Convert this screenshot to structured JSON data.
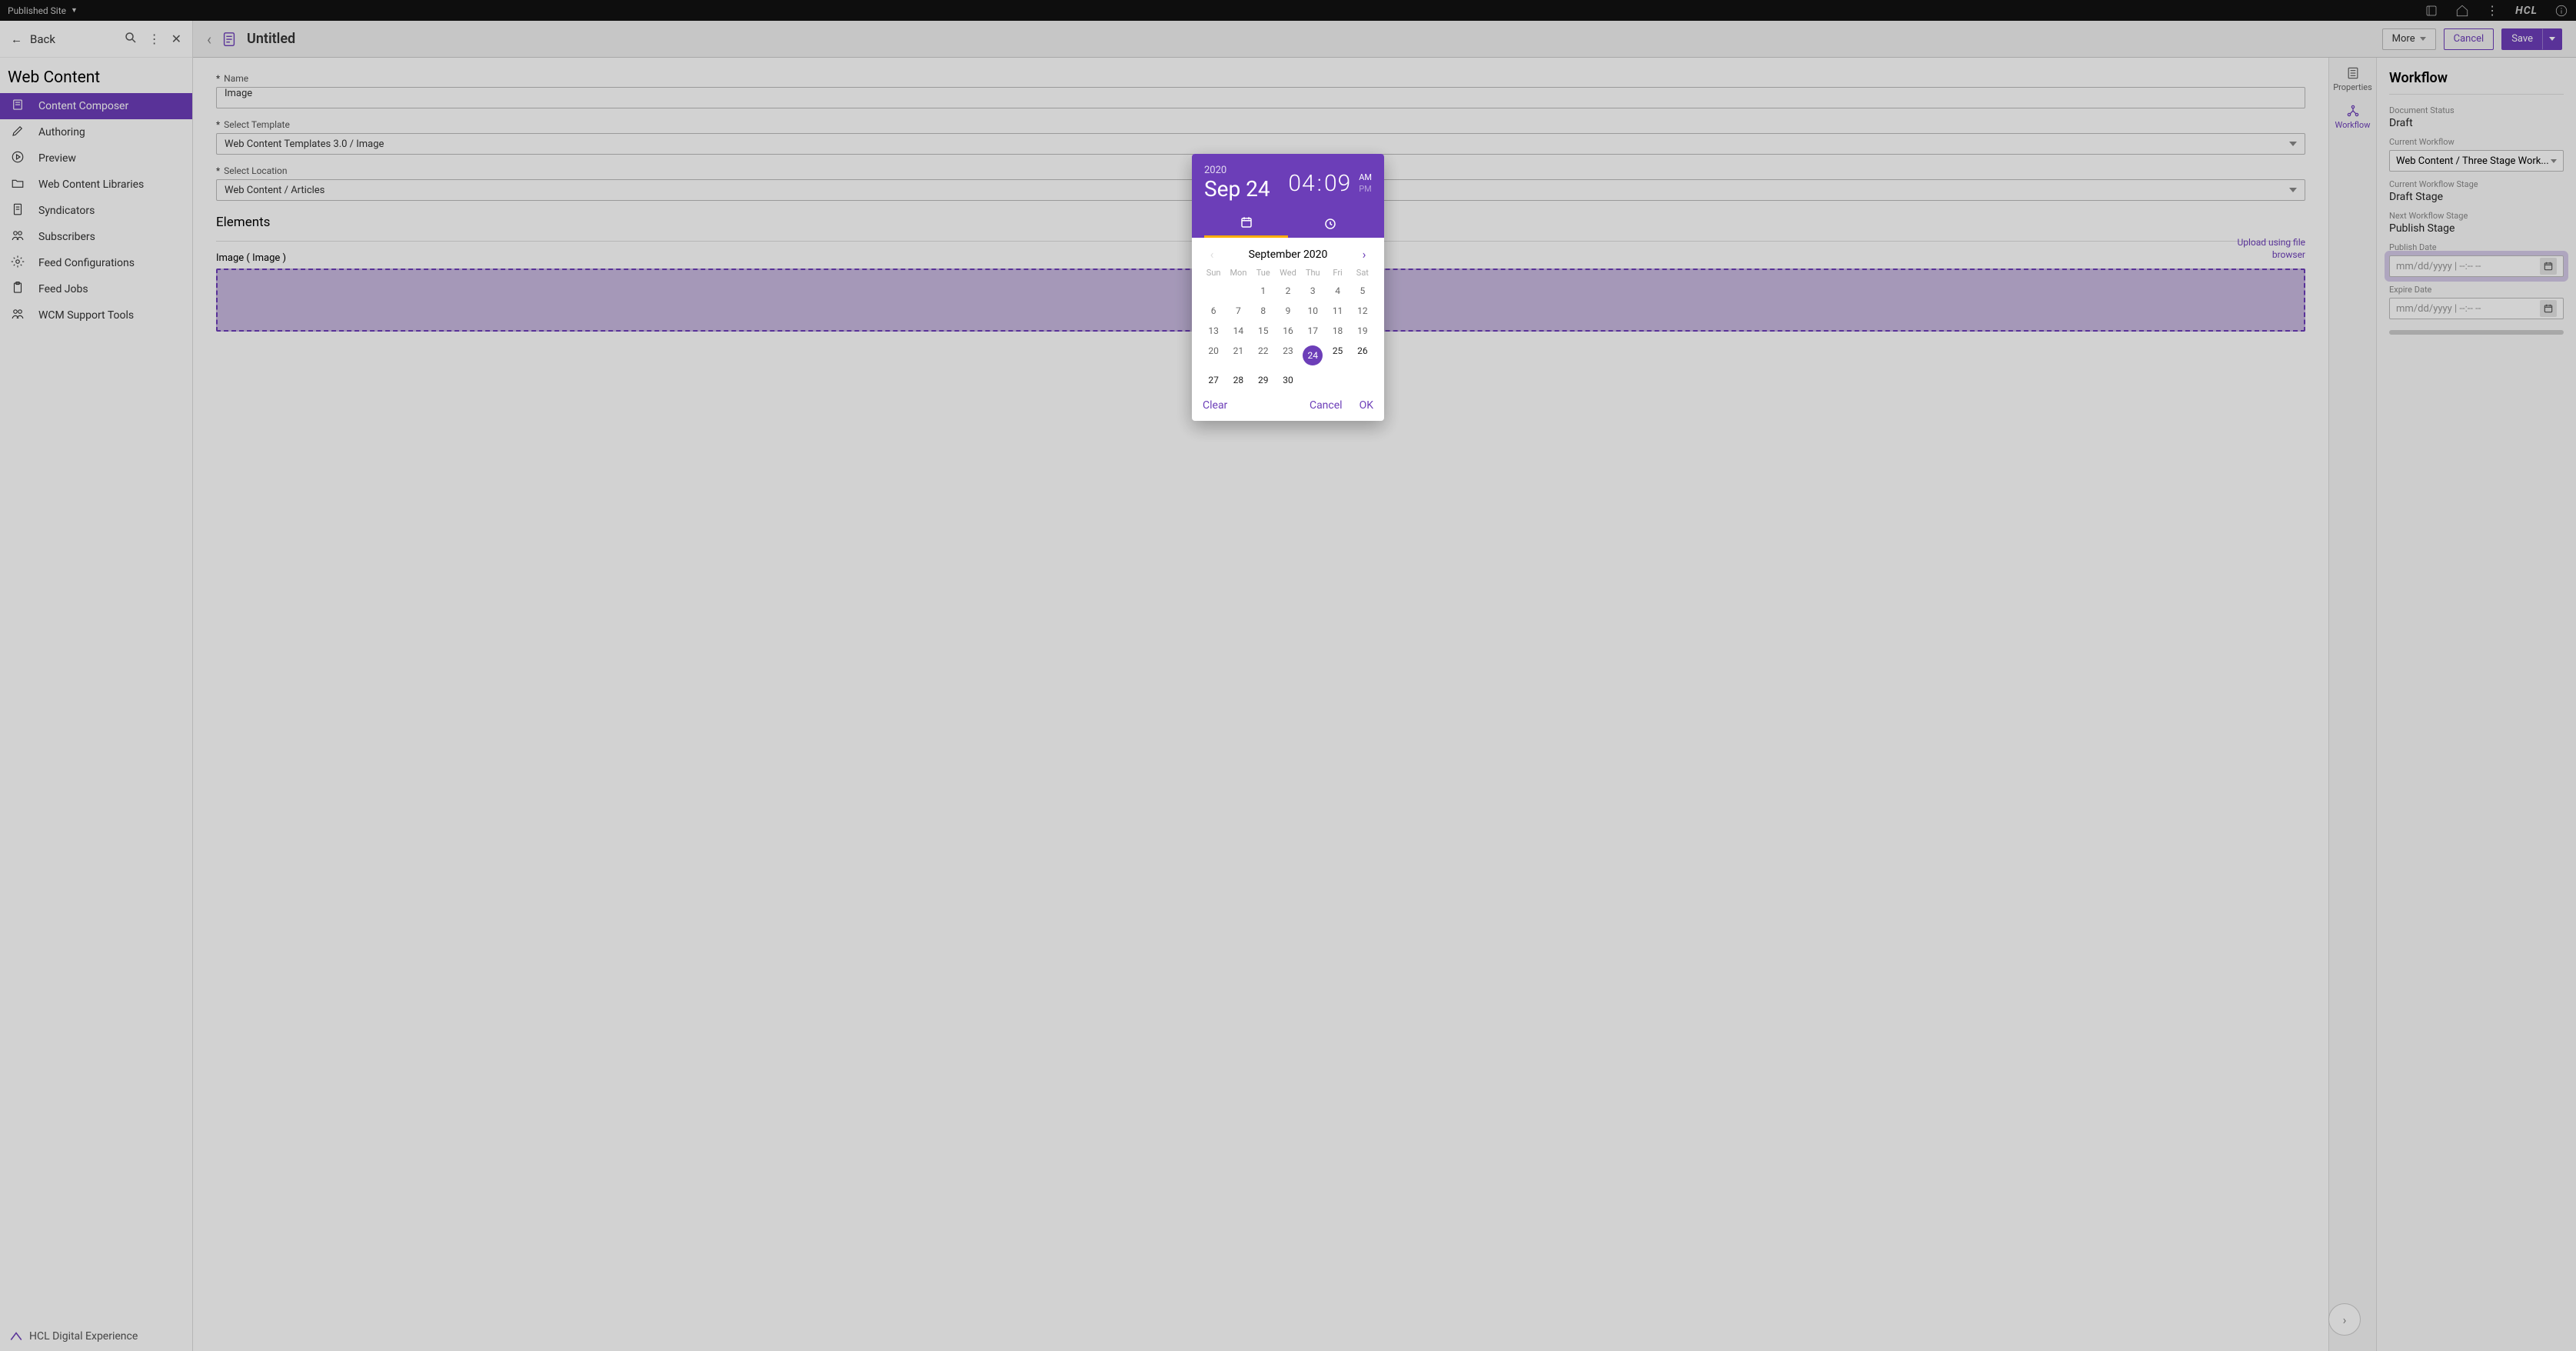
{
  "topbar": {
    "site_label": "Published Site",
    "logo_text": "HCL"
  },
  "sidebar": {
    "back_label": "Back",
    "title": "Web Content",
    "items": [
      {
        "label": "Content Composer",
        "icon": "page-icon",
        "active": true
      },
      {
        "label": "Authoring",
        "icon": "pencil-icon"
      },
      {
        "label": "Preview",
        "icon": "play-icon"
      },
      {
        "label": "Web Content Libraries",
        "icon": "folder-icon"
      },
      {
        "label": "Syndicators",
        "icon": "doc-icon"
      },
      {
        "label": "Subscribers",
        "icon": "people-icon"
      },
      {
        "label": "Feed Configurations",
        "icon": "gear-icon"
      },
      {
        "label": "Feed Jobs",
        "icon": "clipboard-icon"
      },
      {
        "label": "WCM Support Tools",
        "icon": "people-icon"
      }
    ],
    "footer_label": "HCL Digital Experience"
  },
  "editor_header": {
    "title": "Untitled",
    "more_label": "More",
    "cancel_label": "Cancel",
    "save_label": "Save"
  },
  "form": {
    "name_label": " Name",
    "name_value": "Image",
    "template_label": " Select Template",
    "template_value": "Web Content Templates 3.0 / Image",
    "location_label": " Select Location",
    "location_value": "Web Content / Articles",
    "elements_title": "Elements",
    "image_element_label": "Image ( Image )",
    "upload_link_line1": "Upload using file",
    "upload_link_line2": "browser"
  },
  "side_tabs": {
    "properties": "Properties",
    "workflow": "Workflow"
  },
  "workflow": {
    "title": "Workflow",
    "doc_status_label": "Document Status",
    "doc_status_value": "Draft",
    "current_wf_label": "Current Workflow",
    "current_wf_value": "Web Content / Three Stage Work...",
    "current_stage_label": "Current Workflow Stage",
    "current_stage_value": "Draft Stage",
    "next_stage_label": "Next Workflow Stage",
    "next_stage_value": "Publish Stage",
    "publish_date_label": "Publish Date",
    "publish_date_placeholder": "mm/dd/yyyy | --:-- --",
    "expire_date_label": "Expire Date",
    "expire_date_placeholder": "mm/dd/yyyy | --:-- --"
  },
  "datepicker": {
    "year": "2020",
    "date_text": "Sep 24",
    "hour": "04",
    "minute": "09",
    "am": "AM",
    "pm": "PM",
    "am_dim": false,
    "pm_dim": true,
    "month_title": "September 2020",
    "dow": [
      "Sun",
      "Mon",
      "Tue",
      "Wed",
      "Thu",
      "Fri",
      "Sat"
    ],
    "leading_empty": 2,
    "days_in_month": 30,
    "selected_day": 24,
    "dark_from_day": 25,
    "clear_label": "Clear",
    "cancel_label": "Cancel",
    "ok_label": "OK"
  }
}
